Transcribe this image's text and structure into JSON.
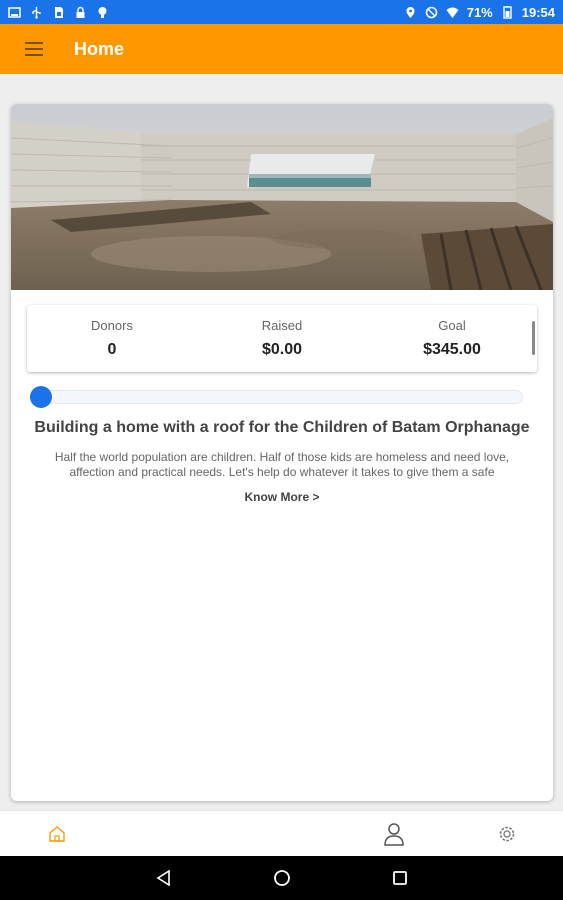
{
  "status_bar": {
    "battery": "71%",
    "time": "19:54",
    "left_icons": [
      "image-icon",
      "usb-icon",
      "sim-icon",
      "lock-icon",
      "bulb-icon"
    ],
    "right_icons": [
      "location-icon",
      "dnd-icon",
      "wifi-icon",
      "battery-icon"
    ]
  },
  "app_bar": {
    "title": "Home",
    "menu_icon": "hamburger-menu-icon"
  },
  "campaign": {
    "image": "abandoned-building-interior",
    "stats": [
      {
        "label": "Donors",
        "value": "0"
      },
      {
        "label": "Raised",
        "value": "$0.00"
      },
      {
        "label": "Goal",
        "value": "$345.00"
      }
    ],
    "progress_fraction": 0,
    "title": "Building a home with a roof for the Children of Batam Orphanage",
    "description": "Half the world population are children. Half of those kids are homeless and need love, affection and practical needs. Let's help do whatever it takes to give them a safe",
    "know_more": "Know More >"
  },
  "bottom_nav": {
    "items": [
      {
        "icon": "home-icon",
        "active": true
      },
      {
        "icon": "user-icon",
        "active": false
      },
      {
        "icon": "settings-gear-icon",
        "active": false
      }
    ]
  },
  "system_nav": {
    "items": [
      "back-icon",
      "home-circle-icon",
      "recents-icon"
    ]
  },
  "colors": {
    "status_bar": "#1a73e8",
    "app_bar": "#ff9800",
    "accent": "#1a73e8",
    "active_nav": "#ff9800"
  }
}
